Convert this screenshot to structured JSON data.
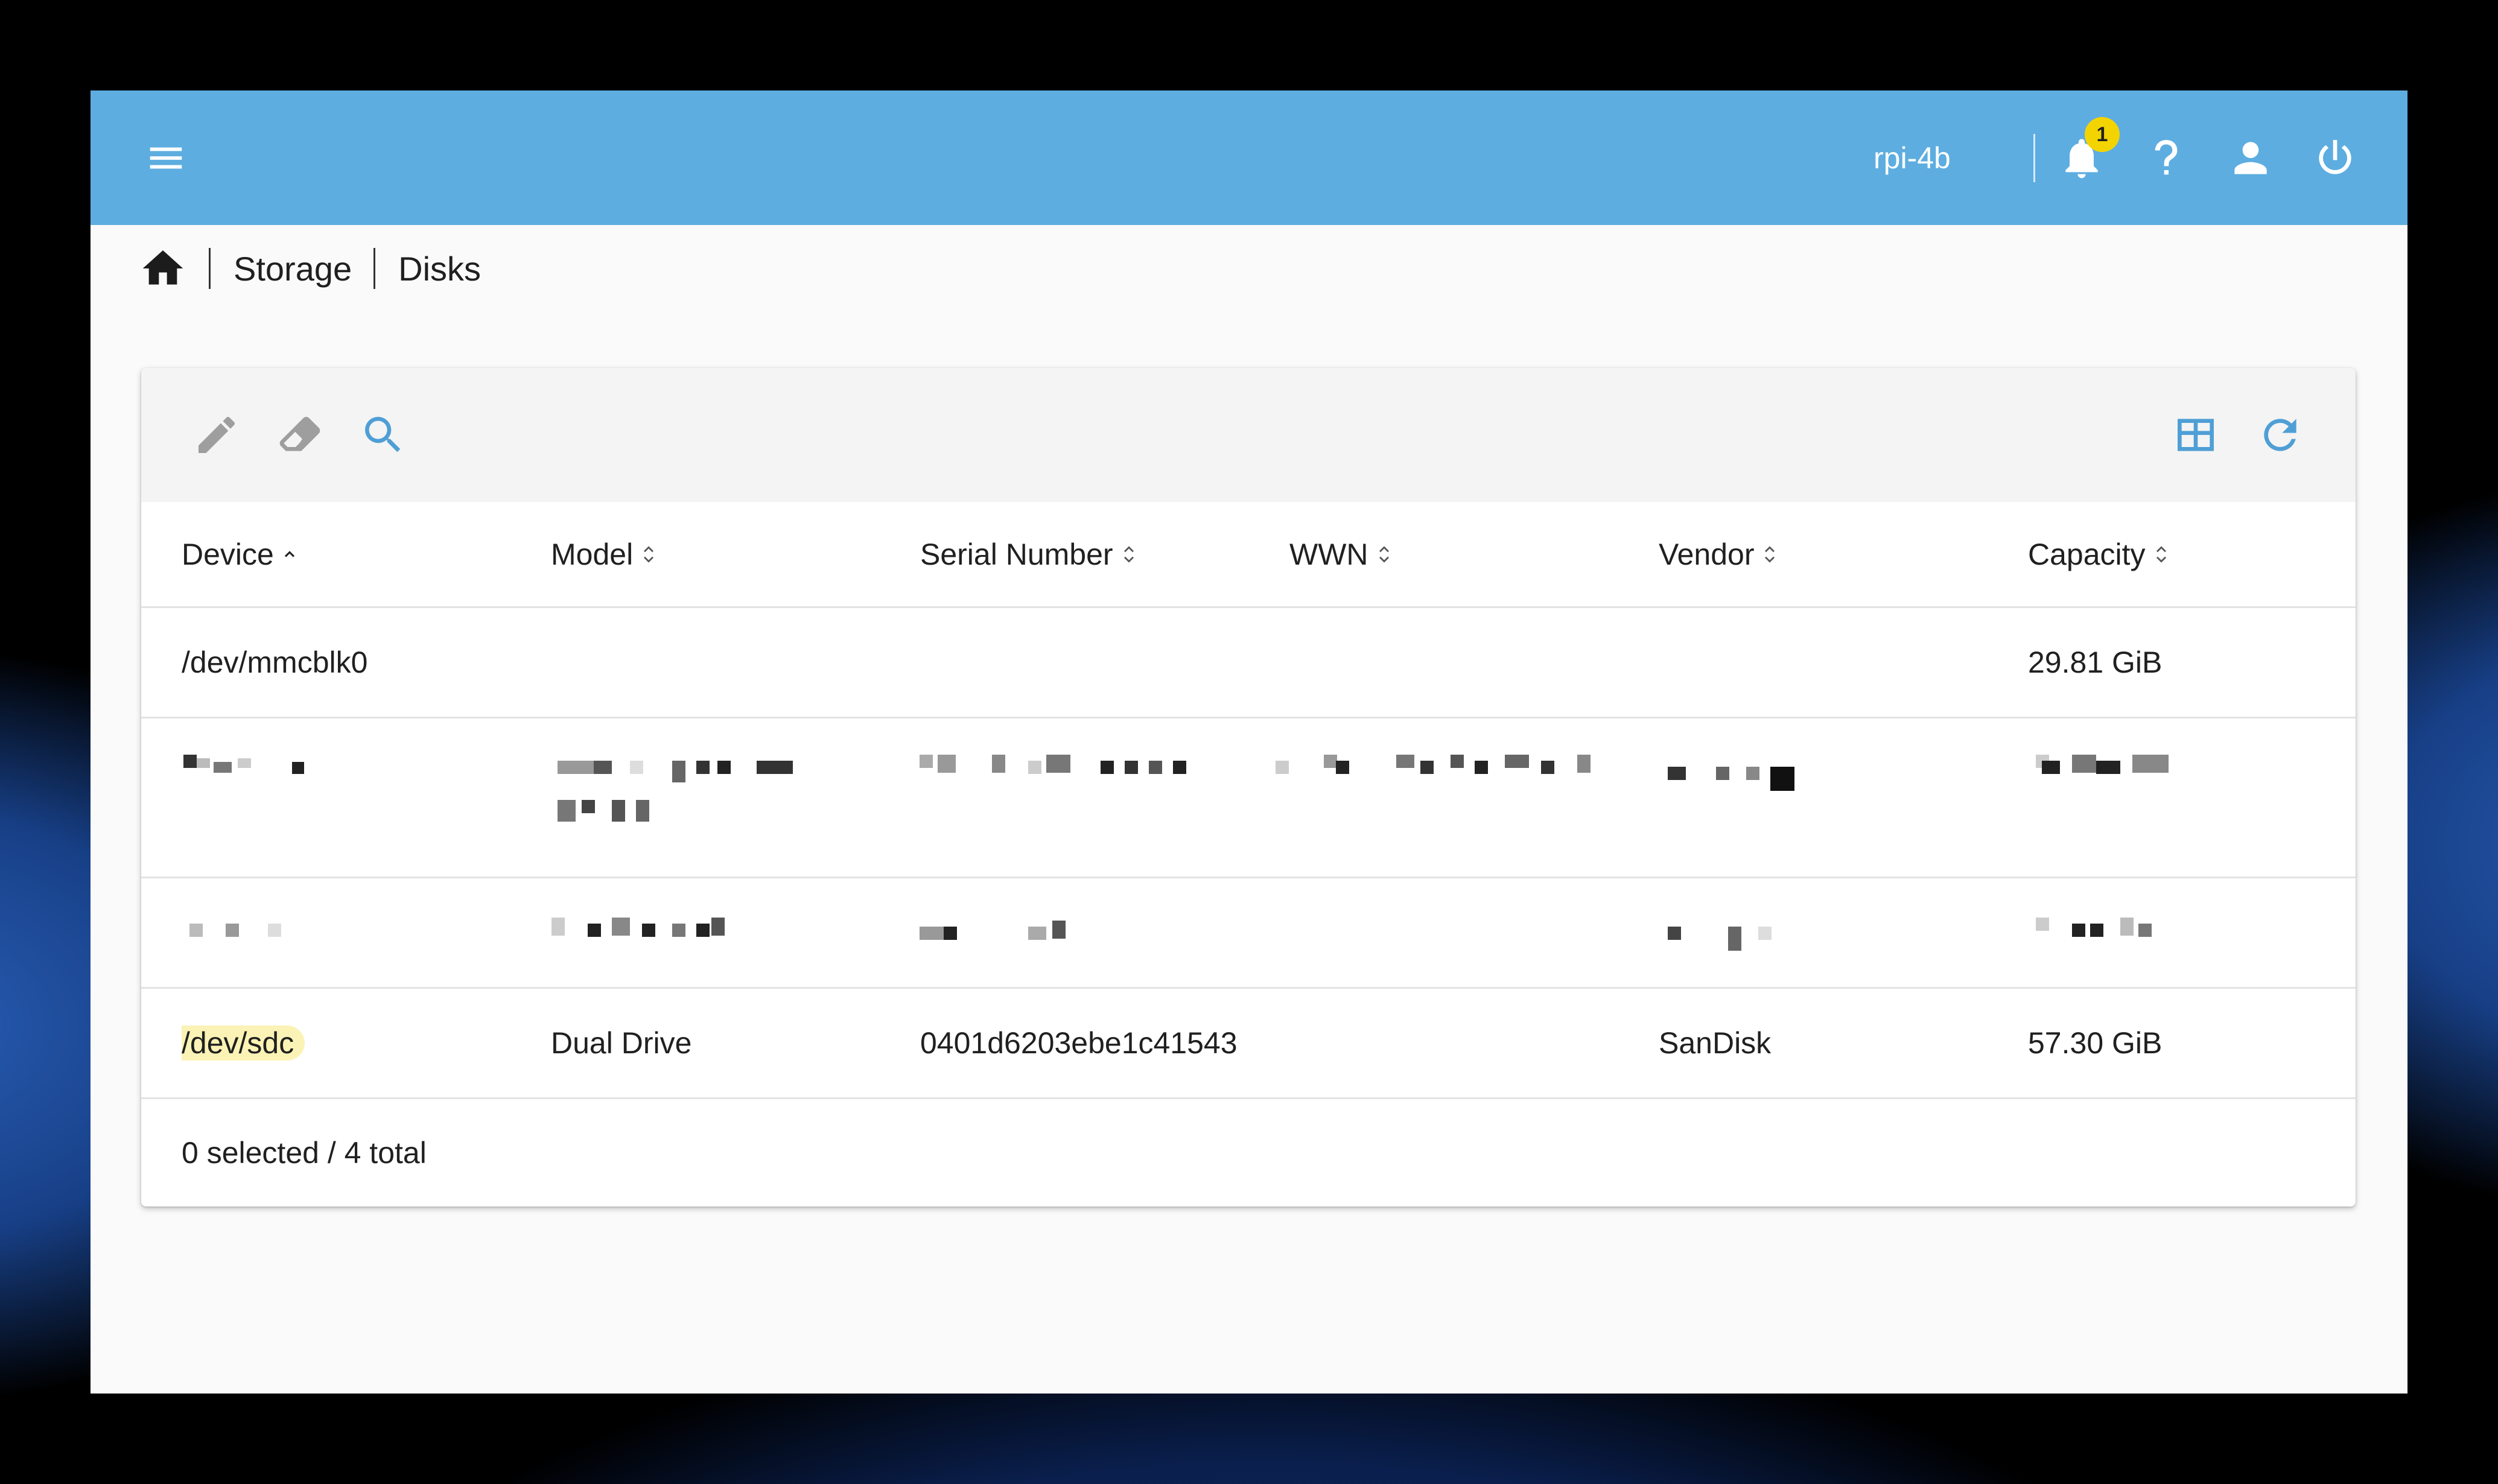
{
  "app": {
    "hostname": "rpi-4b",
    "notification_count": "1",
    "accent_color": "#5dade0",
    "icons": [
      "menu-icon",
      "bell-icon",
      "help-icon",
      "account-icon",
      "power-icon",
      "home-icon",
      "pencil-icon",
      "eraser-icon",
      "search-icon",
      "table-columns-icon",
      "refresh-icon"
    ]
  },
  "breadcrumb": {
    "items": [
      "Storage",
      "Disks"
    ]
  },
  "table": {
    "columns": [
      {
        "label": "Device",
        "sort": "ascending"
      },
      {
        "label": "Model",
        "sort": "none"
      },
      {
        "label": "Serial Number",
        "sort": "none"
      },
      {
        "label": "WWN",
        "sort": "none"
      },
      {
        "label": "Vendor",
        "sort": "none"
      },
      {
        "label": "Capacity",
        "sort": "none"
      }
    ],
    "rows": [
      {
        "device": "/dev/mmcblk0",
        "model": "",
        "serial": "",
        "wwn": "",
        "vendor": "",
        "capacity": "29.81 GiB",
        "redacted": false
      },
      {
        "device": "",
        "model": "",
        "serial": "",
        "wwn": "",
        "vendor": "",
        "capacity": "",
        "redacted": true
      },
      {
        "device": "",
        "model": "",
        "serial": "",
        "wwn": "",
        "vendor": "",
        "capacity": "",
        "redacted": true
      },
      {
        "device": "/dev/sdc",
        "model": "Dual Drive",
        "serial": "0401d6203ebe1c41543",
        "wwn": "",
        "vendor": "SanDisk",
        "capacity": "57.30 GiB",
        "redacted": false,
        "highlighted": true
      }
    ],
    "footer": "0 selected / 4 total"
  }
}
